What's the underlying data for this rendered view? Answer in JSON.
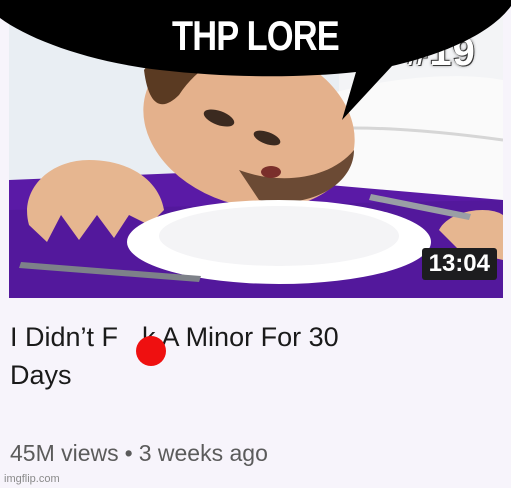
{
  "overlay": {
    "caption": "THP LORE"
  },
  "thumbnail": {
    "duration": "13:04",
    "corner_text": "DAY #19"
  },
  "video": {
    "title_line1": "I Didn’t F",
    "title_line1_rest": "k A Minor For 30",
    "title_line2": "Days",
    "views": "45M views",
    "separator": "•",
    "age": "3 weeks ago"
  },
  "footer": {
    "credit": "imgflip.com"
  },
  "colors": {
    "censor_dot": "#ef1010",
    "tablecloth": "#5a1aa6",
    "bubble": "#000000"
  }
}
